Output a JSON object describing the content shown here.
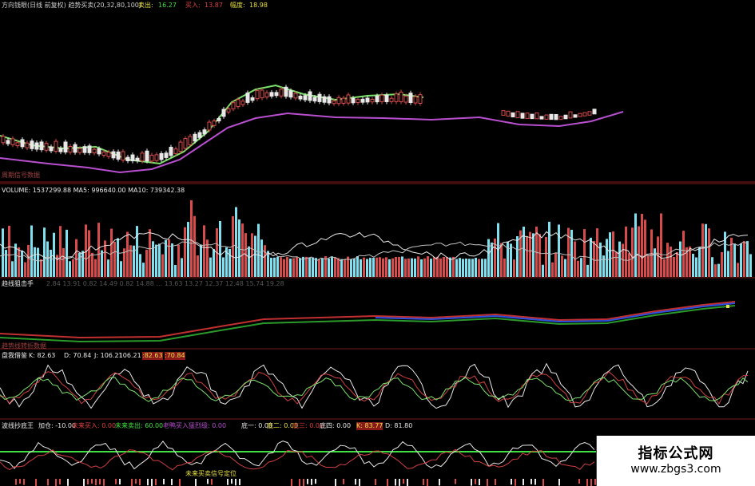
{
  "colors": {
    "background": "#000000",
    "divider": "#7a1c1c",
    "up_bar": "#d94a4a",
    "down_bar": "#7fe0ef",
    "ma_green": "#7be36b",
    "ma_purple": "#b84fcf",
    "white_line": "#e8e8e8",
    "label_red": "#e04040",
    "label_yellow": "#e8e040",
    "label_green": "#40e040"
  },
  "main_panel": {
    "header": "方向钱眼(日线 前复权) 趋势买卖(20,32,80,100)",
    "sell_label": "卖出:",
    "sell_value": "16.27",
    "buy_label": "买入:",
    "buy_value": "13.87",
    "range_label": "幅度:",
    "range_value": "18.98",
    "footer": "周期信号数据"
  },
  "volume_panel": {
    "header": "VOLUME: 1537299.88  MA5: 996640.00  MA10: 739342.38"
  },
  "trend_panel": {
    "header": "趋线狙击手",
    "values": "2.84  13.91  0.82  14.49  0.82  14.88  ...  13.63  13.27  12.37  12.48  15.74  19.28",
    "footer": "趋势线转折数据"
  },
  "kdj_panel": {
    "header": "盘我借鉴",
    "k": "K: 82.63",
    "d": "D: 70.84",
    "j": "J: 106.21",
    "extra1": ":106.21",
    "extra2": ":82.63",
    "extra3": ":70.84"
  },
  "bottom_panel": {
    "header": "波线抄底王",
    "v1": "加仓: -10.00",
    "v2": "未来买入: 0.00",
    "v3": "未来卖出: 60.00",
    "v4": "老鸭买入猛烈级: 0.00",
    "v5": "底一: 0.00",
    "v6": "底二: 0.00",
    "v7": "底三: 0.00",
    "v8": "底四: 0.00",
    "v9": "K: 83.77",
    "v10": "D: 81.80",
    "marker": "未来买卖信号定位"
  },
  "watermark": {
    "title": "指标公式网",
    "url": "www.zbgs3.com"
  }
}
